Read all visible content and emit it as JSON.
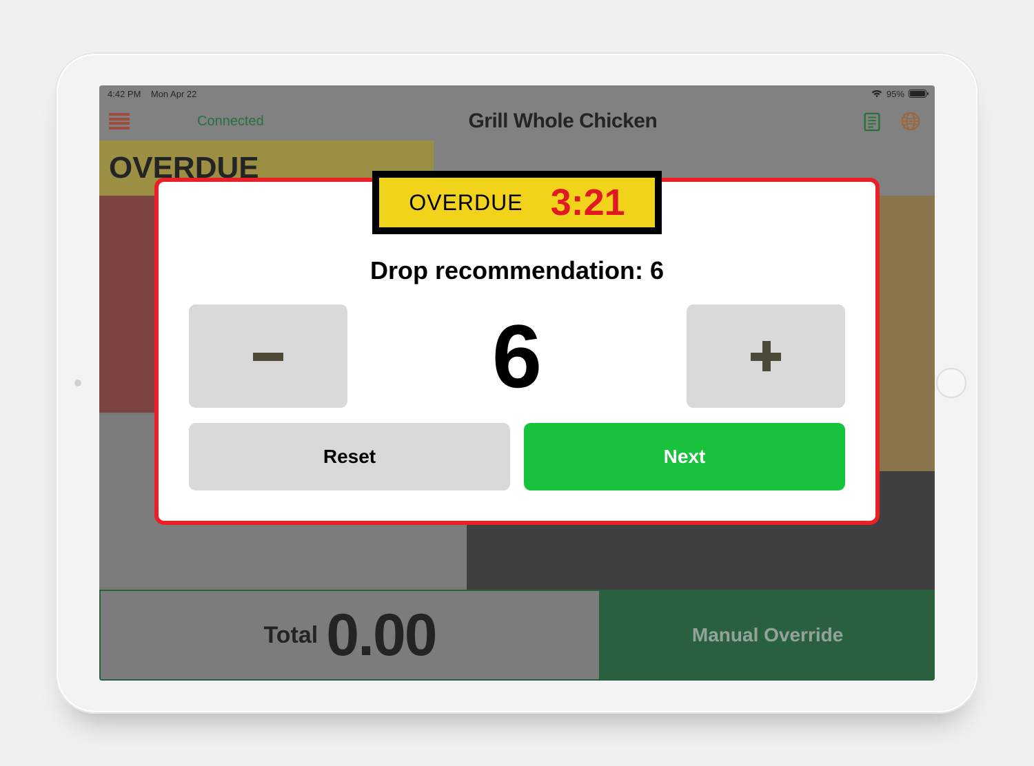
{
  "statusbar": {
    "time": "4:42 PM",
    "date": "Mon Apr 22",
    "battery_pct": "95%"
  },
  "header": {
    "connection_status": "Connected",
    "title": "Grill Whole Chicken"
  },
  "background": {
    "overdue_label": "OVERDUE",
    "total_label": "Total",
    "total_value": "0.00",
    "override_label": "Manual Override"
  },
  "modal": {
    "overdue_label": "OVERDUE",
    "overdue_time": "3:21",
    "recommendation_label": "Drop recommendation: 6",
    "value": "6",
    "reset_label": "Reset",
    "next_label": "Next"
  }
}
